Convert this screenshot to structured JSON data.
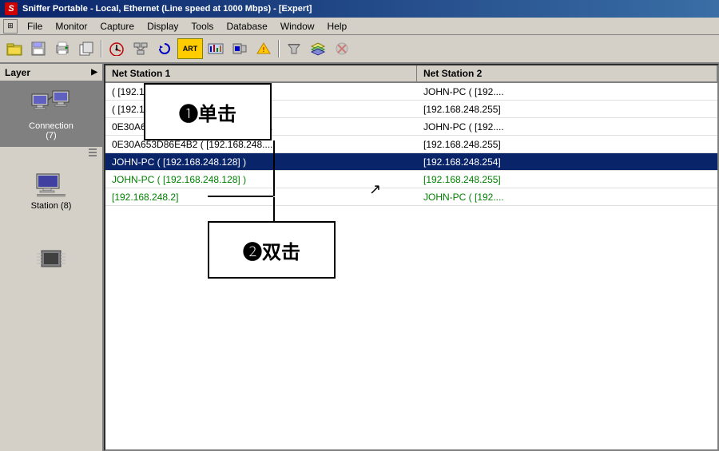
{
  "titleBar": {
    "logo": "S",
    "title": "Sniffer Portable - Local, Ethernet (Line speed at 1000 Mbps) - [Expert]"
  },
  "menuBar": {
    "items": [
      "File",
      "Monitor",
      "Capture",
      "Display",
      "Tools",
      "Database",
      "Window",
      "Help"
    ]
  },
  "toolbar": {
    "buttons": [
      "📂",
      "💾",
      "🖨️",
      "📋",
      "📊",
      "🔄",
      "🎨",
      "🔀",
      "🎭",
      "📋",
      "⚠️",
      "🔍",
      "📦",
      "🚫"
    ]
  },
  "sidebar": {
    "header": "Layer",
    "items": [
      {
        "id": "connection",
        "label": "Connection\n(7)",
        "selected": true
      },
      {
        "id": "station",
        "label": "Station (8)",
        "selected": false
      },
      {
        "id": "protocol",
        "label": "",
        "selected": false
      }
    ]
  },
  "table": {
    "headers": [
      "Net Station 1",
      "Net Station 2"
    ],
    "rows": [
      {
        "col1": "( [192.168.248....",
        "col2": "JOHN-PC ( [192....",
        "selected": false,
        "green": false
      },
      {
        "col1": "( [192.168.248....",
        "col2": "[192.168.248.255]",
        "selected": false,
        "green": false
      },
      {
        "col1": "0E30A653D86E4B2 ( [192.168.248....",
        "col2": "JOHN-PC ( [192....",
        "selected": false,
        "green": false
      },
      {
        "col1": "0E30A653D86E4B2 ( [192.168.248....",
        "col2": "[192.168.248.255]",
        "selected": false,
        "green": false
      },
      {
        "col1": "JOHN-PC ( [192.168.248.128] )",
        "col2": "[192.168.248.254]",
        "selected": true,
        "green": false
      },
      {
        "col1": "JOHN-PC ( [192.168.248.128] )",
        "col2": "[192.168.248.255]",
        "selected": false,
        "green": true
      },
      {
        "col1": "[192.168.248.2]",
        "col2": "JOHN-PC ( [192....",
        "selected": false,
        "green": true
      }
    ]
  },
  "annotations": {
    "box1": "❶单击",
    "box2": "❷双击"
  }
}
